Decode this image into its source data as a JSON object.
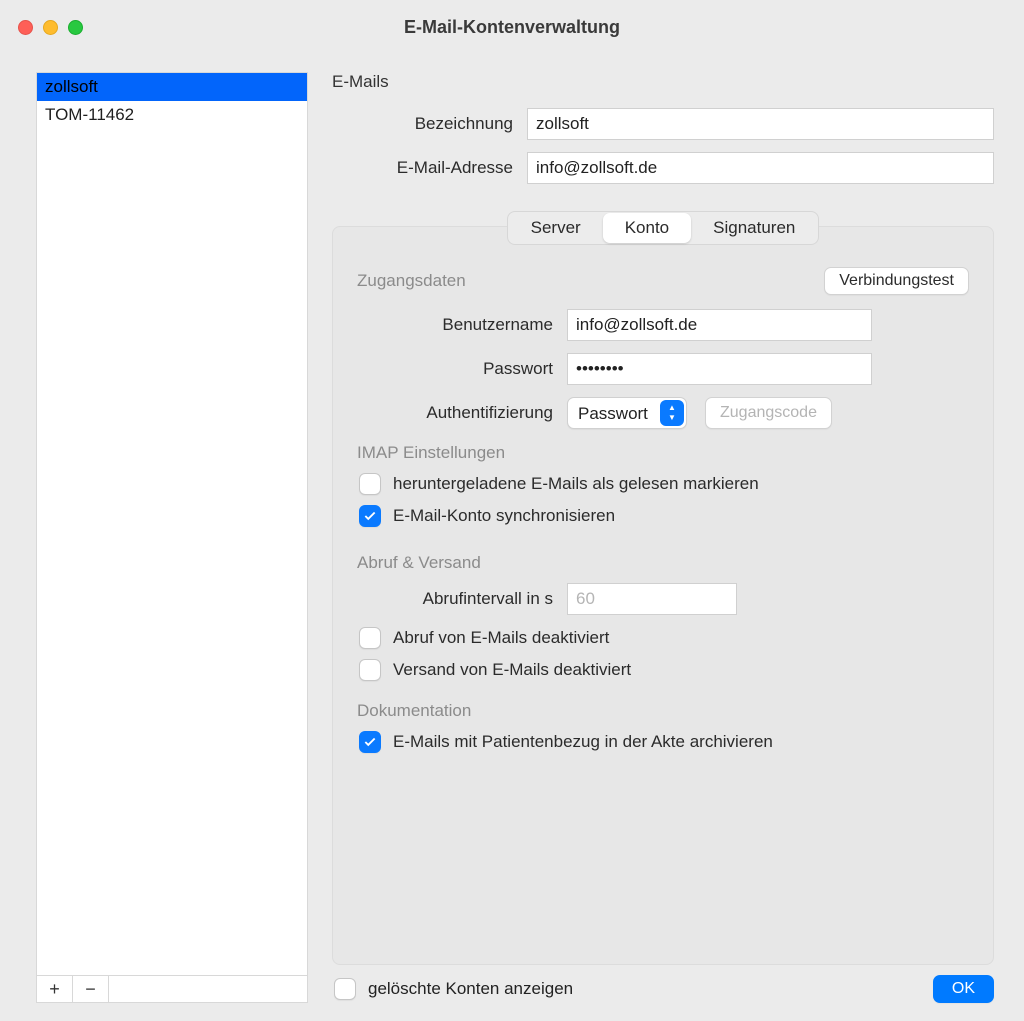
{
  "window": {
    "title": "E-Mail-Kontenverwaltung"
  },
  "sidebar": {
    "items": [
      {
        "label": "zollsoft",
        "active": true
      },
      {
        "label": "TOM-11462",
        "active": false
      }
    ],
    "add_label": "+",
    "remove_label": "−"
  },
  "main": {
    "section_title": "E-Mails",
    "name_label": "Bezeichnung",
    "name_value": "zollsoft",
    "email_label": "E-Mail-Adresse",
    "email_value": "info@zollsoft.de"
  },
  "tabs": {
    "server": "Server",
    "konto": "Konto",
    "signaturen": "Signaturen"
  },
  "creds": {
    "title": "Zugangsdaten",
    "test_btn": "Verbindungstest",
    "user_label": "Benutzername",
    "user_value": "info@zollsoft.de",
    "pass_label": "Passwort",
    "pass_value": "••••••••",
    "auth_label": "Authentifizierung",
    "auth_selected": "Passwort",
    "code_btn": "Zugangscode"
  },
  "imap": {
    "title": "IMAP Einstellungen",
    "mark_read": "heruntergeladene E-Mails als gelesen markieren",
    "sync": "E-Mail-Konto synchronisieren"
  },
  "fetch": {
    "title": "Abruf & Versand",
    "interval_label": "Abrufintervall in s",
    "interval_placeholder": "60",
    "disable_fetch": "Abruf von E-Mails deaktiviert",
    "disable_send": "Versand von E-Mails deaktiviert"
  },
  "doc": {
    "title": "Dokumentation",
    "archive": "E-Mails mit Patientenbezug in der Akte archivieren"
  },
  "footer": {
    "show_deleted": "gelöschte Konten anzeigen",
    "ok": "OK"
  },
  "state": {
    "mark_read_checked": false,
    "sync_checked": true,
    "disable_fetch_checked": false,
    "disable_send_checked": false,
    "archive_checked": true,
    "show_deleted_checked": false
  },
  "colors": {
    "accent": "#0a7aff"
  }
}
